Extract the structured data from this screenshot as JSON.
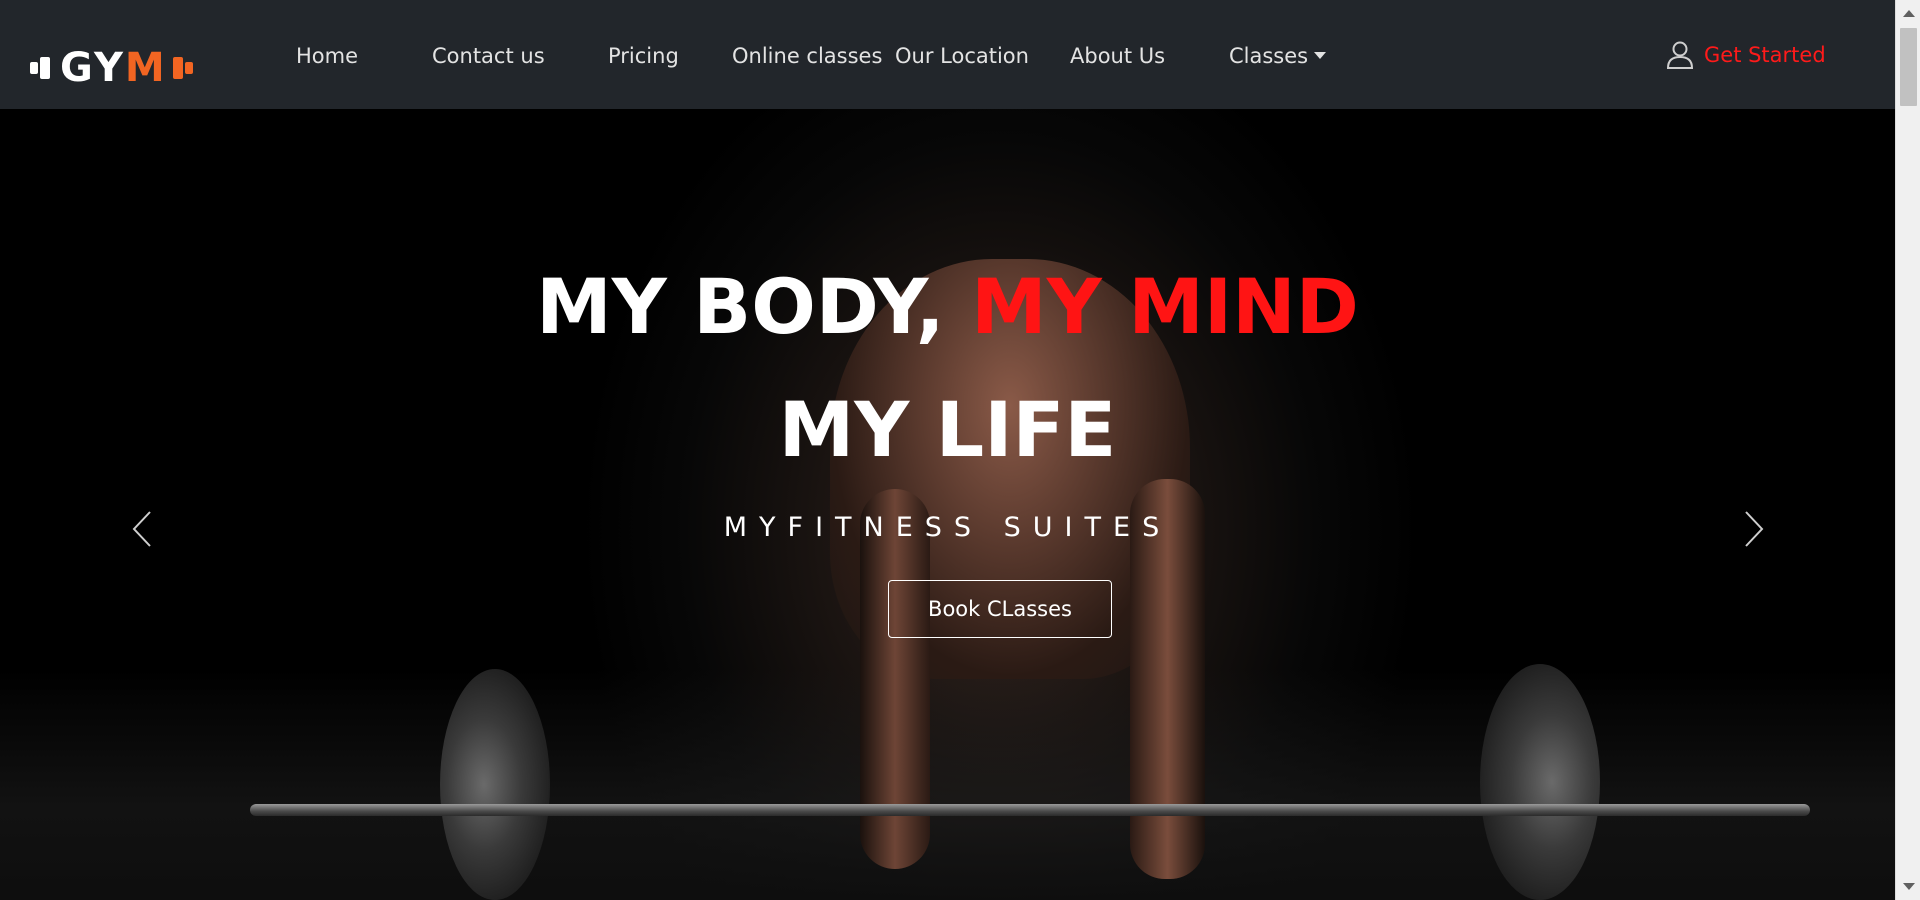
{
  "brand": {
    "logo_left": "GY",
    "logo_right": "M"
  },
  "nav": {
    "items": [
      {
        "label": "Home"
      },
      {
        "label": "Contact us"
      },
      {
        "label": "Pricing"
      },
      {
        "label": "Online classes"
      },
      {
        "label": "Our Location"
      },
      {
        "label": "About Us"
      },
      {
        "label": "Classes"
      }
    ],
    "get_started": "Get Started"
  },
  "hero": {
    "line1_white": "MY BODY, ",
    "line1_red": "MY MIND",
    "line2": "MY LIFE",
    "subtitle": "MYFITNESS SUITES",
    "cta": "Book CLasses"
  },
  "colors": {
    "navbar_bg": "#22262b",
    "accent_red": "#ff1414",
    "logo_orange": "#f26522"
  },
  "icons": {
    "user": "user-icon",
    "prev": "chevron-left-icon",
    "next": "chevron-right-icon",
    "dropdown": "caret-down-icon"
  }
}
